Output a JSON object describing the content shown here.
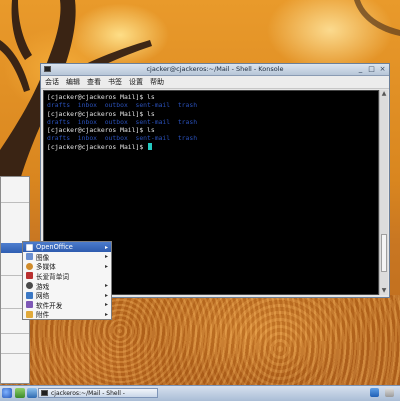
{
  "window": {
    "title": "cjacker@cjackeros:~/Mail - Shell - Konsole",
    "controls": [
      "_",
      "□",
      "×"
    ]
  },
  "menubar": {
    "items": [
      "会话",
      "编辑",
      "查看",
      "书签",
      "设置",
      "帮助"
    ]
  },
  "terminal": {
    "lines": [
      {
        "prompt": "[cjacker@cjackeros Mail]$ ",
        "command": "ls"
      },
      {
        "output": "drafts  inbox  outbox  sent-mail  trash"
      },
      {
        "prompt": "[cjacker@cjackeros Mail]$ ",
        "command": "ls"
      },
      {
        "output": "drafts  inbox  outbox  sent-mail  trash"
      },
      {
        "prompt": "[cjacker@cjackeros Mail]$ ",
        "command": "ls"
      },
      {
        "output": "drafts  inbox  outbox  sent-mail  trash"
      },
      {
        "prompt": "[cjacker@cjackeros Mail]$ ",
        "command": ""
      }
    ],
    "colors": {
      "background": "#000000",
      "text": "#e6e6e6",
      "directory": "#2a50b8",
      "cursor": "#24c9c0"
    }
  },
  "submenu": {
    "items": [
      {
        "label": "OpenOffice",
        "active": true,
        "icon": "openoffice-icon",
        "color": "#ffffff"
      },
      {
        "label": "图像",
        "active": false,
        "icon": "image-icon",
        "color": "#6a8fd0"
      },
      {
        "label": "多媒体",
        "active": false,
        "icon": "multimedia-icon",
        "color": "#d08b2a"
      },
      {
        "label": "长爱背单词",
        "active": false,
        "icon": "vocabulary-icon",
        "color": "#b93030"
      },
      {
        "label": "游戏",
        "active": false,
        "icon": "games-icon",
        "color": "#4a4a4a"
      },
      {
        "label": "网络",
        "active": false,
        "icon": "network-icon",
        "color": "#3b78c4"
      },
      {
        "label": "软件开发",
        "active": false,
        "icon": "development-icon",
        "color": "#7e58b6"
      },
      {
        "label": "附件",
        "active": false,
        "icon": "accessories-icon",
        "color": "#e1a93a"
      }
    ]
  },
  "taskbar": {
    "task_label": "cjackeros:~/Mail - Shell -"
  }
}
